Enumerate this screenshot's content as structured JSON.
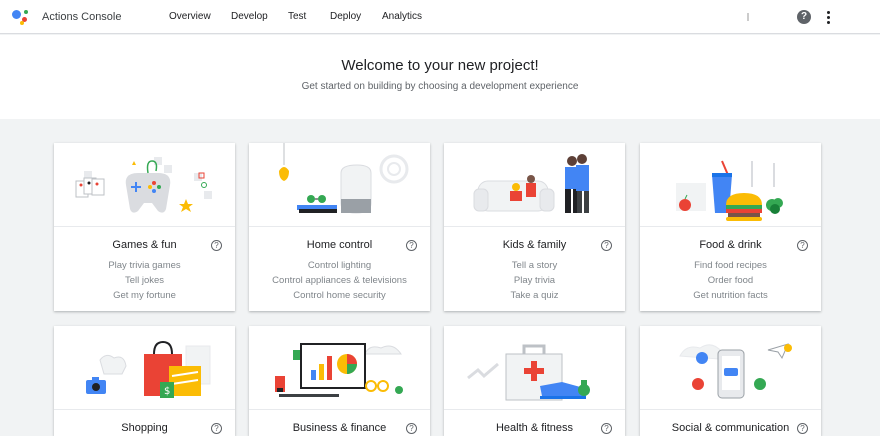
{
  "header": {
    "app_title": "Actions Console",
    "nav": [
      "Overview",
      "Develop",
      "Test",
      "Deploy",
      "Analytics"
    ],
    "help_label": "?"
  },
  "welcome": {
    "title": "Welcome to your new project!",
    "subtitle": "Get started on building by choosing a development experience"
  },
  "categories": [
    {
      "title": "Games & fun",
      "illustration": "game-controller-icon",
      "examples": [
        "Play trivia games",
        "Tell jokes",
        "Get my fortune"
      ]
    },
    {
      "title": "Home control",
      "illustration": "smart-speaker-icon",
      "examples": [
        "Control lighting",
        "Control appliances & televisions",
        "Control home security"
      ]
    },
    {
      "title": "Kids & family",
      "illustration": "family-icon",
      "examples": [
        "Tell a story",
        "Play trivia",
        "Take a quiz"
      ]
    },
    {
      "title": "Food & drink",
      "illustration": "burger-drink-icon",
      "examples": [
        "Find food recipes",
        "Order food",
        "Get nutrition facts"
      ]
    },
    {
      "title": "Shopping",
      "illustration": "shopping-bags-icon",
      "examples": []
    },
    {
      "title": "Business & finance",
      "illustration": "chart-monitor-icon",
      "examples": []
    },
    {
      "title": "Health & fitness",
      "illustration": "first-aid-icon",
      "examples": []
    },
    {
      "title": "Social & communication",
      "illustration": "phone-chat-icon",
      "examples": []
    }
  ],
  "colors": {
    "blue": "#4285f4",
    "red": "#ea4335",
    "yellow": "#fbbc05",
    "green": "#34a853"
  }
}
